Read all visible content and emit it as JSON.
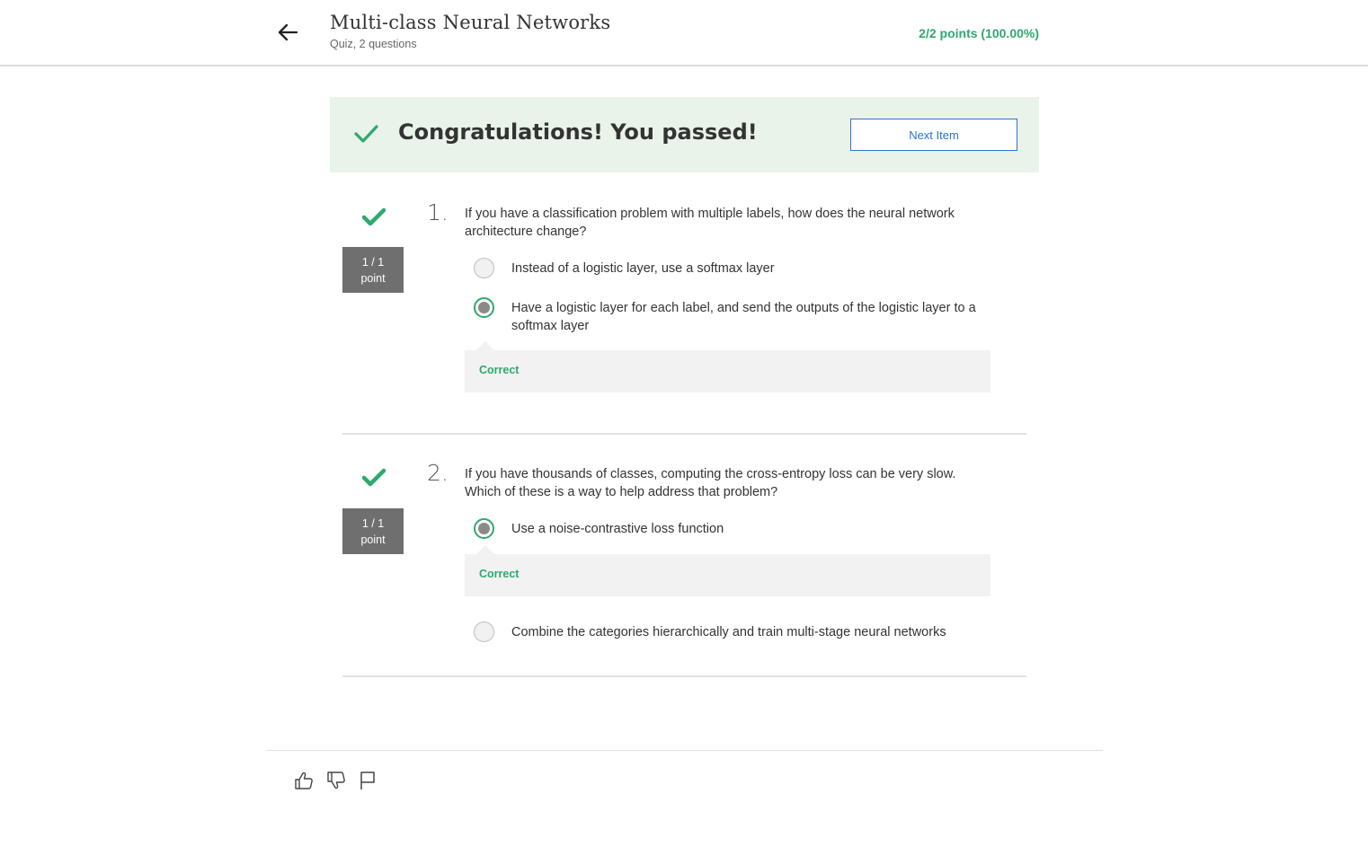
{
  "header": {
    "title": "Multi-class Neural Networks",
    "subtitle": "Quiz, 2 questions",
    "score": "2/2 points (100.00%)"
  },
  "banner": {
    "message": "Congratulations! You passed!",
    "next_button": "Next Item"
  },
  "questions": [
    {
      "number": "1.",
      "points_top": "1 / 1",
      "points_bottom": "point",
      "text": "If you have a classification problem with multiple labels, how does the neural network architecture change?",
      "options": [
        {
          "label": "Instead of a logistic layer, use a softmax layer",
          "selected": false
        },
        {
          "label": "Have a logistic layer for each label, and send the outputs of the logistic layer to a softmax layer",
          "selected": true
        }
      ],
      "feedback": "Correct"
    },
    {
      "number": "2.",
      "points_top": "1 / 1",
      "points_bottom": "point",
      "text": "If you have thousands of classes, computing the cross-entropy loss can be very slow. Which of these is a way to help address that problem?",
      "options": [
        {
          "label": "Use a noise-contrastive loss function",
          "selected": true
        },
        {
          "label": "Combine the categories hierarchically and train multi-stage neural networks",
          "selected": false
        }
      ],
      "feedback": "Correct"
    }
  ],
  "colors": {
    "accent_green": "#2fa86d",
    "link_blue": "#2a73cc",
    "banner_bg": "#e9f3e9"
  },
  "footer": {
    "icons": [
      "thumbs-up-icon",
      "thumbs-down-icon",
      "flag-icon"
    ]
  }
}
